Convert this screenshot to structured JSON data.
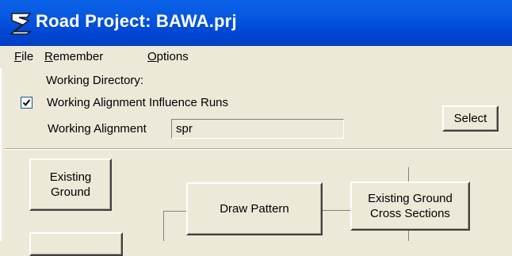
{
  "window": {
    "title": "Road Project: BAWA.prj"
  },
  "menu": {
    "items": [
      {
        "first": "F",
        "rest": "ile"
      },
      {
        "first": "R",
        "rest": "emember"
      },
      {
        "first": "O",
        "rest": "ptions"
      }
    ]
  },
  "working_directory_label": "Working Directory:",
  "influence_runs": {
    "label": "Working Alignment Influence Runs",
    "checked": true
  },
  "working_alignment": {
    "label": "Working Alignment",
    "value": "spr"
  },
  "select_button": "Select",
  "flow": {
    "existing_ground": [
      "Existing",
      "Ground"
    ],
    "draw_pattern": "Draw Pattern",
    "existing_ground_cross_sections": [
      "Existing Ground",
      "Cross Sections"
    ]
  }
}
